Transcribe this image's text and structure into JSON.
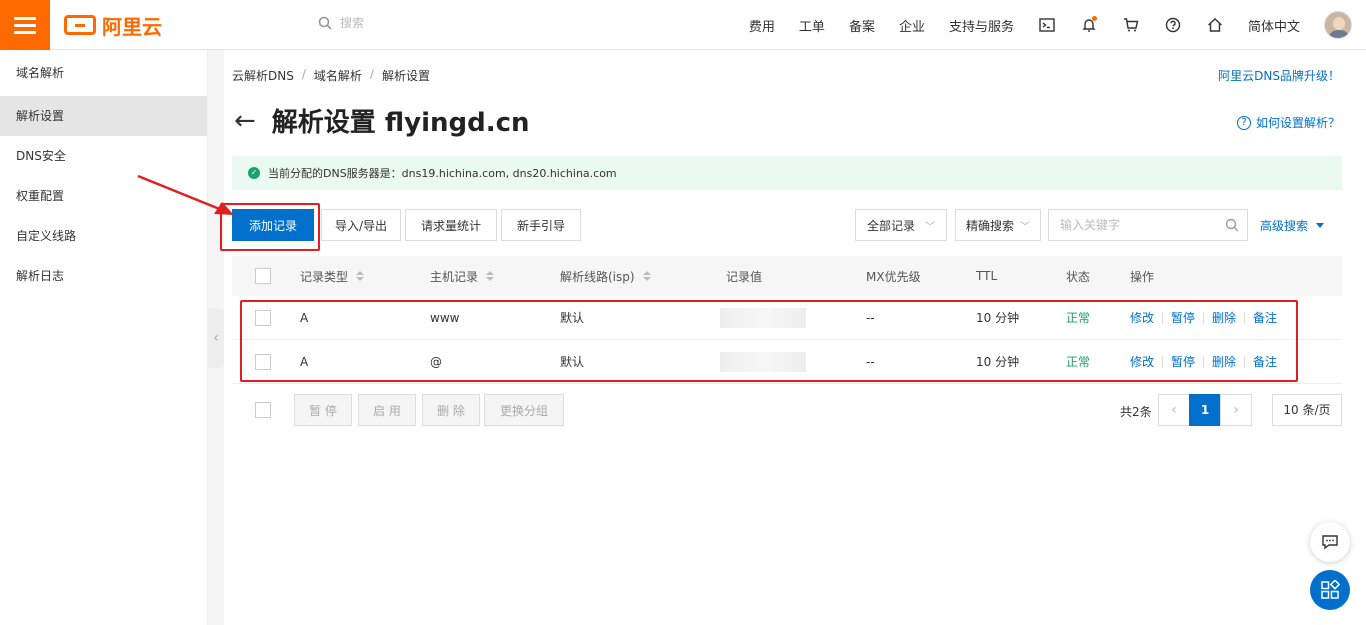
{
  "topbar": {
    "logo_text": "阿里云",
    "search_placeholder": "搜索",
    "nav": [
      "费用",
      "工单",
      "备案",
      "企业",
      "支持与服务"
    ],
    "language": "简体中文",
    "brand_color": "#ff6a00"
  },
  "sidebar": {
    "items": [
      "域名解析",
      "解析设置",
      "DNS安全",
      "权重配置",
      "自定义线路",
      "解析日志"
    ],
    "active": "解析设置"
  },
  "main": {
    "breadcrumb": [
      "云解析DNS",
      "域名解析",
      "解析设置"
    ],
    "top_link": "阿里云DNS品牌升级！",
    "title": "解析设置 flyingd.cn",
    "help_link": "如何设置解析？",
    "notice": "当前分配的DNS服务器是：dns19.hichina.com, dns20.hichina.com",
    "toolbar": {
      "add": "添加记录",
      "import_export": "导入/导出",
      "stats": "请求量统计",
      "guide": "新手引导",
      "filter_all": "全部记录",
      "exact_search": "精确搜索",
      "keyword_placeholder": "输入关键字",
      "advanced": "高级搜索"
    },
    "table": {
      "headers": [
        "记录类型",
        "主机记录",
        "解析线路(isp)",
        "记录值",
        "MX优先级",
        "TTL",
        "状态",
        "操作"
      ],
      "rows": [
        {
          "type": "A",
          "host": "www",
          "line": "默认",
          "mx": "--",
          "ttl": "10 分钟",
          "status": "正常"
        },
        {
          "type": "A",
          "host": "@",
          "line": "默认",
          "mx": "--",
          "ttl": "10 分钟",
          "status": "正常"
        }
      ],
      "ops": [
        "修改",
        "暂停",
        "删除",
        "备注"
      ]
    },
    "batch": {
      "pause": "暂 停",
      "enable": "启 用",
      "delete": "删 除",
      "regroup": "更换分组"
    },
    "pager": {
      "total": "共2条",
      "current": "1",
      "page_size": "10 条/页"
    }
  }
}
